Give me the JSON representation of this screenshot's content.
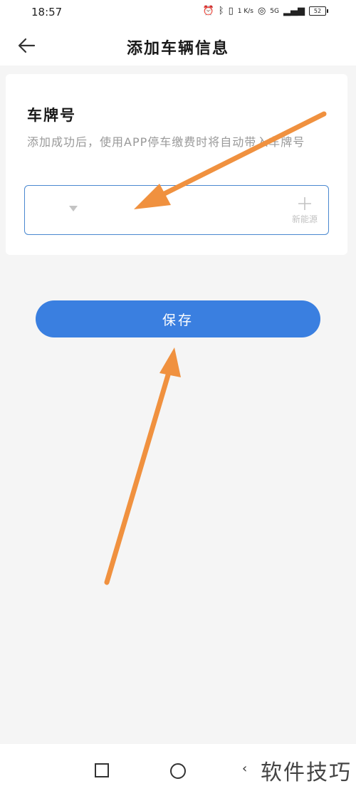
{
  "status_bar": {
    "time": "18:57",
    "net_speed": "1 K/s",
    "network": "5G",
    "battery": "52"
  },
  "nav": {
    "title": "添加车辆信息",
    "back_icon": "arrow-left-icon"
  },
  "plate_card": {
    "title": "车牌号",
    "description": "添加成功后，使用APP停车缴费时将自动带入车牌号",
    "input_value": "",
    "dropdown_icon": "triangle-down-icon",
    "new_energy_label": "新能源",
    "new_energy_icon": "plus-icon"
  },
  "save_label": "保存",
  "system_nav": {
    "recent_icon": "square-icon",
    "home_icon": "circle-icon",
    "back_icon": "triangle-left-icon"
  },
  "watermark": "软件技巧",
  "colors": {
    "accent": "#3a7fe0",
    "input_border": "#4a88d0",
    "annotation_arrow": "#f0913f",
    "background": "#f5f5f5"
  }
}
